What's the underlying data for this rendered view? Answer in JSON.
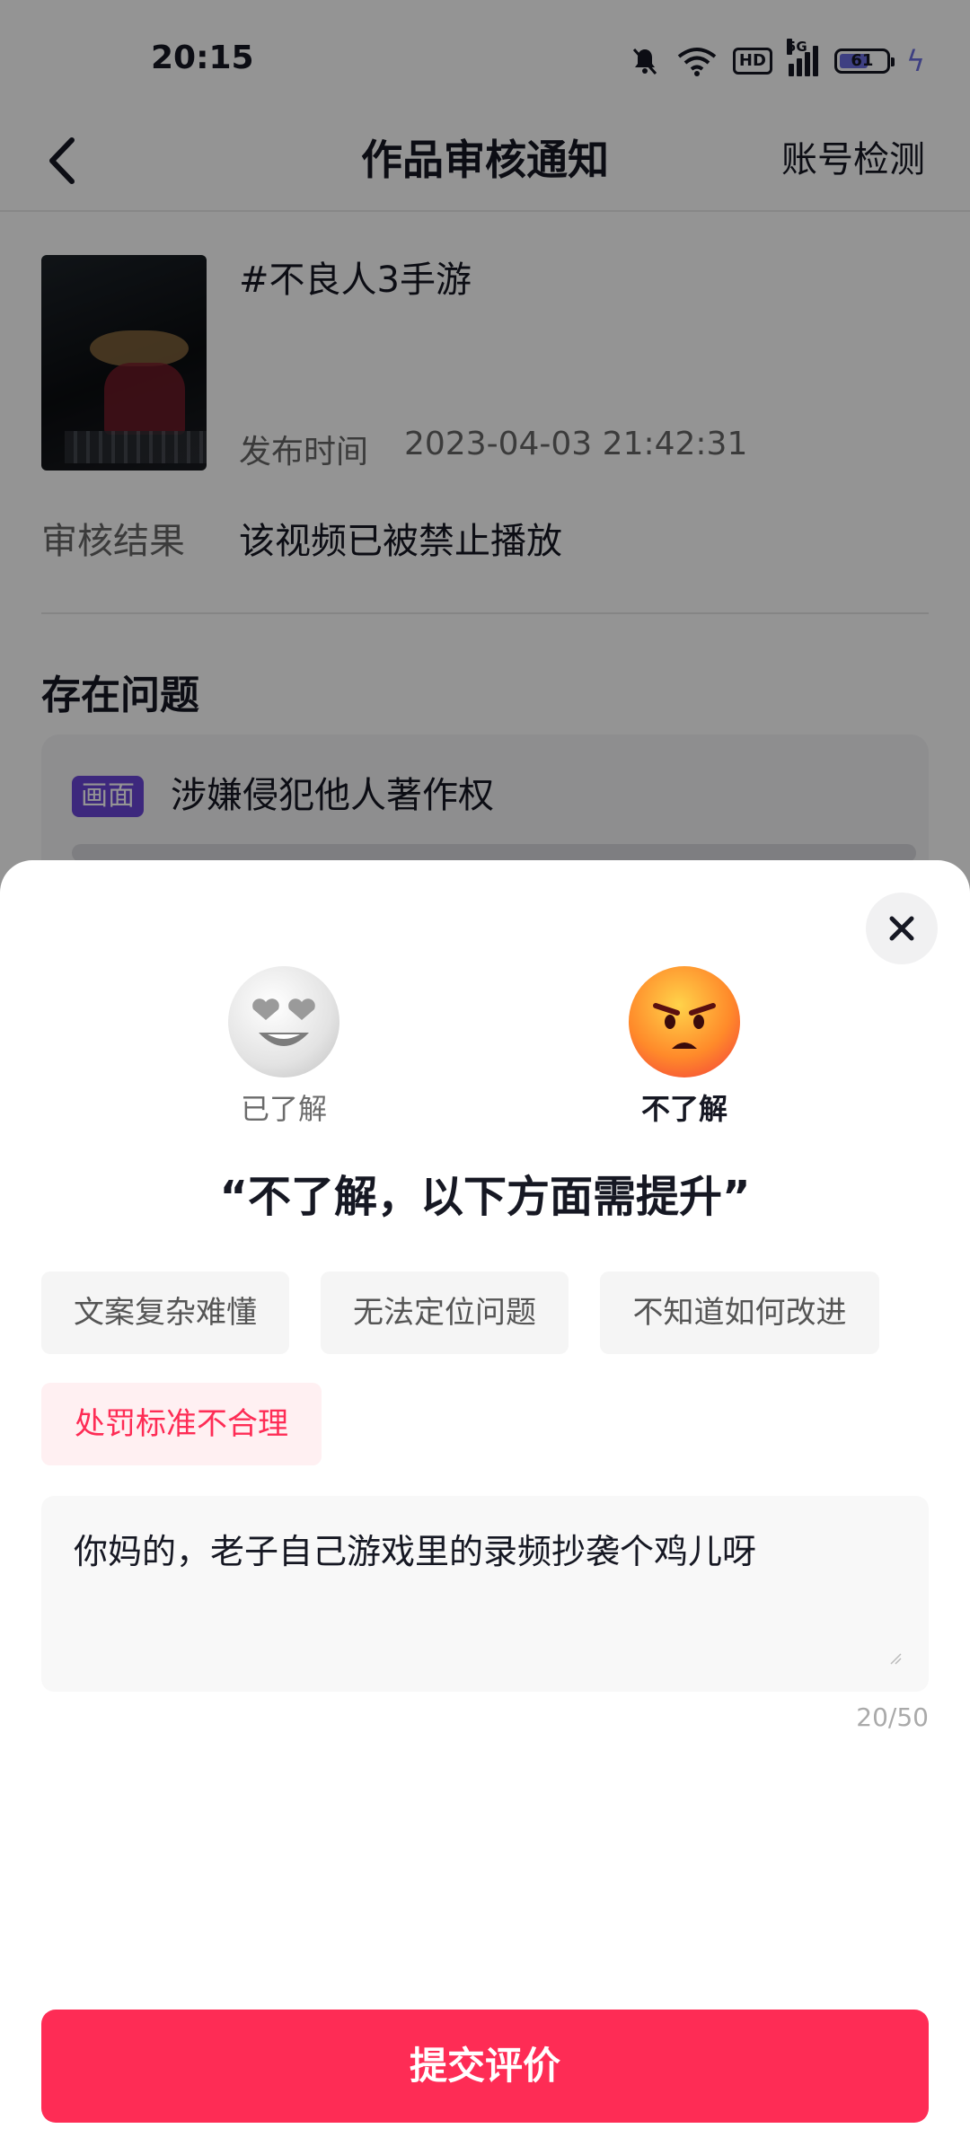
{
  "status_bar": {
    "time": "20:15",
    "network_label": "5G",
    "hd_label": "HD",
    "battery": "61"
  },
  "header": {
    "title": "作品审核通知",
    "right_action": "账号检测"
  },
  "work": {
    "title": "#不良人3手游",
    "publish_label": "发布时间",
    "publish_time": "2023-04-03 21:42:31",
    "result_label": "审核结果",
    "result_value": "该视频已被禁止播放"
  },
  "issues": {
    "title": "存在问题",
    "items": [
      {
        "tag": "画面",
        "text": "涉嫌侵犯他人著作权"
      }
    ]
  },
  "sheet": {
    "options": [
      {
        "label": "已了解",
        "icon": "heart-eyes-face-icon",
        "selected": false
      },
      {
        "label": "不了解",
        "icon": "angry-face-icon",
        "selected": true
      }
    ],
    "prompt": "“不了解，以下方面需提升”",
    "chips": [
      {
        "label": "文案复杂难懂",
        "selected": false
      },
      {
        "label": "无法定位问题",
        "selected": false
      },
      {
        "label": "不知道如何改进",
        "selected": false
      },
      {
        "label": "处罚标准不合理",
        "selected": true
      }
    ],
    "feedback_text": "你妈的，老子自己游戏里的录频抄袭个鸡儿呀",
    "counter": "20/50",
    "submit_label": "提交评价"
  },
  "colors": {
    "accent": "#fe2c55",
    "tag_purple": "#6a45d8",
    "selected_chip_bg": "#fff0f2"
  }
}
